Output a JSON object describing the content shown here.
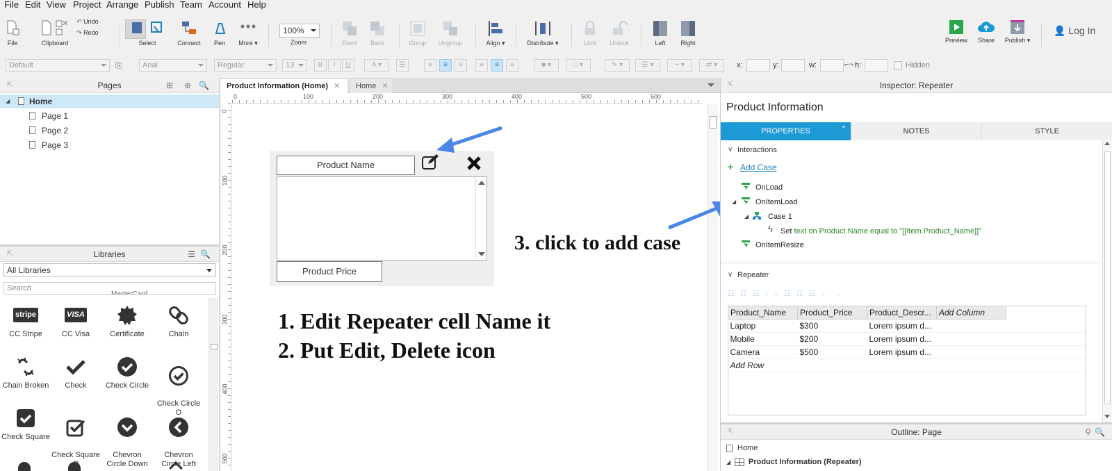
{
  "menubar": {
    "items": [
      "File",
      "Edit",
      "View",
      "Project",
      "Arrange",
      "Publish",
      "Team",
      "Account",
      "Help"
    ]
  },
  "toolbar": {
    "file": "File",
    "clipboard": "Clipboard",
    "undo": "Undo",
    "redo": "Redo",
    "select": "Select",
    "connect": "Connect",
    "pen": "Pen",
    "more": "More ▾",
    "zoom_value": "100%",
    "zoom": "Zoom",
    "front": "Front",
    "back": "Back",
    "group": "Group",
    "ungroup": "Ungroup",
    "align": "Align ▾",
    "distribute": "Distribute ▾",
    "lock": "Lock",
    "unlock": "Unlock",
    "left": "Left",
    "right": "Right",
    "preview": "Preview",
    "share": "Share",
    "publish": "Publish ▾",
    "login": "Log In"
  },
  "formatbar": {
    "style": "Default",
    "font": "Arial",
    "weight": "Regular",
    "size": "13",
    "x_label": "x:",
    "y_label": "y:",
    "w_label": "w:",
    "h_label": "h:",
    "hidden": "Hidden"
  },
  "pages": {
    "title": "Pages",
    "items": [
      {
        "label": "Home",
        "selected": true
      },
      {
        "label": "Page 1"
      },
      {
        "label": "Page 2"
      },
      {
        "label": "Page 3"
      }
    ]
  },
  "libraries": {
    "title": "Libraries",
    "selected": "All Libraries",
    "search_placeholder": "Search",
    "partial_label": "MasterCard",
    "items": [
      {
        "label": "CC Stripe",
        "icon": "stripe-icon",
        "glyph": "stripe"
      },
      {
        "label": "CC Visa",
        "icon": "visa-icon",
        "glyph": "VISA"
      },
      {
        "label": "Certificate",
        "icon": "certificate-icon"
      },
      {
        "label": "Chain",
        "icon": "chain-icon"
      },
      {
        "label": "Chain Broken",
        "icon": "chain-broken-icon"
      },
      {
        "label": "Check",
        "icon": "check-icon"
      },
      {
        "label": "Check Circle",
        "icon": "check-circle-icon"
      },
      {
        "label": "Check Circle\nO",
        "icon": "check-circle-o-icon"
      },
      {
        "label": "Check Square",
        "icon": "check-square-icon"
      },
      {
        "label": "Check Square\nO",
        "icon": "check-square-o-icon"
      },
      {
        "label": "Chevron\nCircle Down",
        "icon": "chevron-circle-down-icon"
      },
      {
        "label": "Chevron\nCircle Left",
        "icon": "chevron-circle-left-icon"
      }
    ]
  },
  "tabs": [
    {
      "label": "Product Information (Home)",
      "active": true
    },
    {
      "label": "Home",
      "active": false
    }
  ],
  "rulers": {
    "h": [
      "0",
      "100",
      "200",
      "300",
      "400",
      "500",
      "600"
    ],
    "v": [
      "0",
      "100",
      "200",
      "300",
      "400",
      "500"
    ]
  },
  "canvas": {
    "product_name": "Product Name",
    "product_price": "Product Price",
    "instruction_1": "1. Edit Repeater cell Name it",
    "instruction_2": "2. Put Edit, Delete icon",
    "instruction_3": "3. click to add case"
  },
  "inspector": {
    "title": "Inspector: Repeater",
    "widget_name": "Product Information",
    "tabs": [
      "PROPERTIES",
      "NOTES",
      "STYLE"
    ],
    "properties_marker": "*",
    "interactions": "Interactions",
    "add_case": "Add Case",
    "events": {
      "onload": "OnLoad",
      "onitemload": "OnItemLoad",
      "case1": "Case 1",
      "action_prefix": "Set ",
      "action_text": "text on Product Name equal to \"[[Item.Product_Name]]\"",
      "onitemresize": "OnItemResize"
    },
    "repeater_section": "Repeater",
    "columns": [
      "Product_Name",
      "Product_Price",
      "Product_Descr...",
      "Add Column"
    ],
    "rows": [
      [
        "Laptop",
        "$300",
        "Lorem ipsum d..."
      ],
      [
        "Mobile",
        "$200",
        "Lorem ipsum d..."
      ],
      [
        "Camera",
        "$500",
        "Lorem ipsum d..."
      ]
    ],
    "add_row": "Add Row"
  },
  "outline": {
    "title": "Outline: Page",
    "root": "Home",
    "child": "Product Information (Repeater)"
  },
  "colors": {
    "accent": "#1d9ad6",
    "arrow": "#4a86e8",
    "action_green": "#2a8a2a",
    "selection": "#cde8f6"
  }
}
